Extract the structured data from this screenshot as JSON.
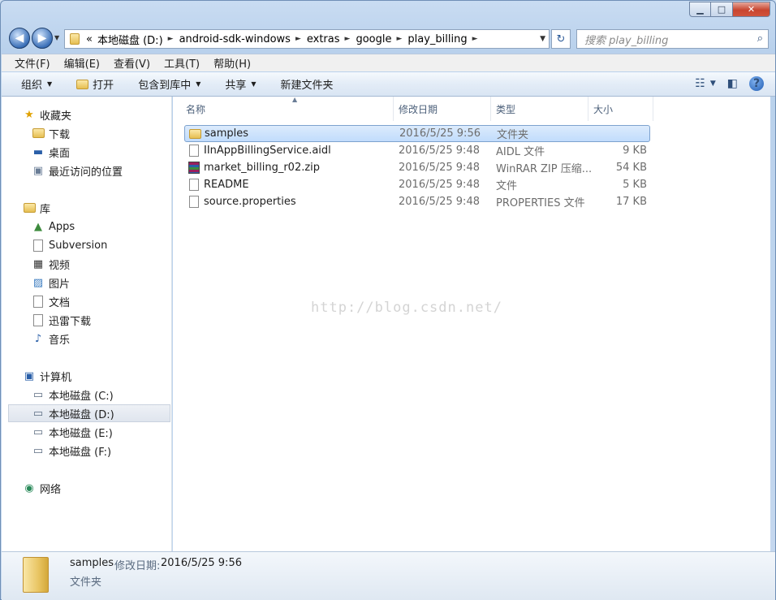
{
  "window": {
    "minimize": "▁",
    "maximize": "□",
    "close": "✕"
  },
  "address": {
    "overflow": "«",
    "segments": [
      "本地磁盘 (D:)",
      "android-sdk-windows",
      "extras",
      "google",
      "play_billing"
    ],
    "separator": "►",
    "dropdown": "▼"
  },
  "refresh_glyph": "↻",
  "search": {
    "placeholder": "搜索 play_billing",
    "glyph": "⌕"
  },
  "menu": [
    "文件(F)",
    "编辑(E)",
    "查看(V)",
    "工具(T)",
    "帮助(H)"
  ],
  "toolbar": {
    "organize": "组织",
    "open": "打开",
    "include": "包含到库中",
    "share": "共享",
    "new_folder": "新建文件夹",
    "help": "?"
  },
  "sidebar": {
    "favorites": {
      "label": "收藏夹",
      "items": [
        "下载",
        "桌面",
        "最近访问的位置"
      ]
    },
    "libraries": {
      "label": "库",
      "items": [
        "Apps",
        "Subversion",
        "视频",
        "图片",
        "文档",
        "迅雷下载",
        "音乐"
      ]
    },
    "computer": {
      "label": "计算机",
      "items": [
        "本地磁盘 (C:)",
        "本地磁盘 (D:)",
        "本地磁盘 (E:)",
        "本地磁盘 (F:)"
      ]
    },
    "network": {
      "label": "网络"
    }
  },
  "columns": {
    "name": "名称",
    "modified": "修改日期",
    "type": "类型",
    "size": "大小",
    "sort": "▲"
  },
  "files": [
    {
      "name": "samples",
      "date": "2016/5/25 9:56",
      "type": "文件夹",
      "size": "",
      "icon": "folder-icon"
    },
    {
      "name": "IInAppBillingService.aidl",
      "date": "2016/5/25 9:48",
      "type": "AIDL 文件",
      "size": "9 KB",
      "icon": "document-icon"
    },
    {
      "name": "market_billing_r02.zip",
      "date": "2016/5/25 9:48",
      "type": "WinRAR ZIP 压缩...",
      "size": "54 KB",
      "icon": "winrar-zip-icon"
    },
    {
      "name": "README",
      "date": "2016/5/25 9:48",
      "type": "文件",
      "size": "5 KB",
      "icon": "document-icon"
    },
    {
      "name": "source.properties",
      "date": "2016/5/25 9:48",
      "type": "PROPERTIES 文件",
      "size": "17 KB",
      "icon": "document-icon"
    }
  ],
  "watermark": "http://blog.csdn.net/",
  "details": {
    "name": "samples",
    "label": "修改日期:",
    "value": "2016/5/25 9:56",
    "type": "文件夹"
  },
  "colors": {
    "accent": "#3b70b8",
    "selection": "#c1dcfc"
  }
}
